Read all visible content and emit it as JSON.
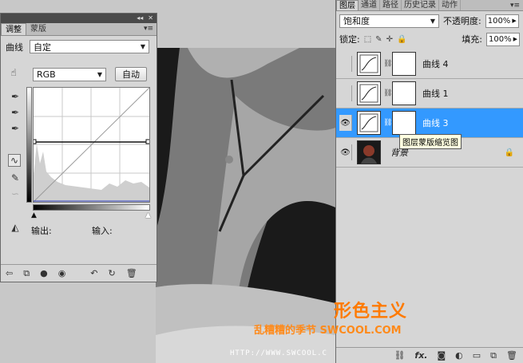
{
  "adjustments": {
    "tabs": [
      "调整",
      "蒙版"
    ],
    "curve_label": "曲线",
    "preset_value": "自定",
    "channel_value": "RGB",
    "auto_button": "自动",
    "output_label": "输出:",
    "input_label": "输入:"
  },
  "layers": {
    "tabs": [
      "图层",
      "通道",
      "路径",
      "历史记录",
      "动作"
    ],
    "blend_mode": "饱和度",
    "opacity_label": "不透明度:",
    "opacity_value": "100%",
    "lock_label": "锁定:",
    "fill_label": "填充:",
    "fill_value": "100%",
    "items": [
      {
        "name": "曲线 4"
      },
      {
        "name": "曲线 1"
      },
      {
        "name": "曲线 3"
      },
      {
        "name": "背景"
      }
    ],
    "tooltip": "图层蒙版缩览图"
  },
  "watermark": {
    "logo": "形色主义",
    "line": "乱糟糟的季节 SWCOOL.COM",
    "url": "HTTP://WWW.SWCOOL.C"
  },
  "colors": {
    "selection": "#3399ff",
    "watermark": "#ff7a00"
  }
}
